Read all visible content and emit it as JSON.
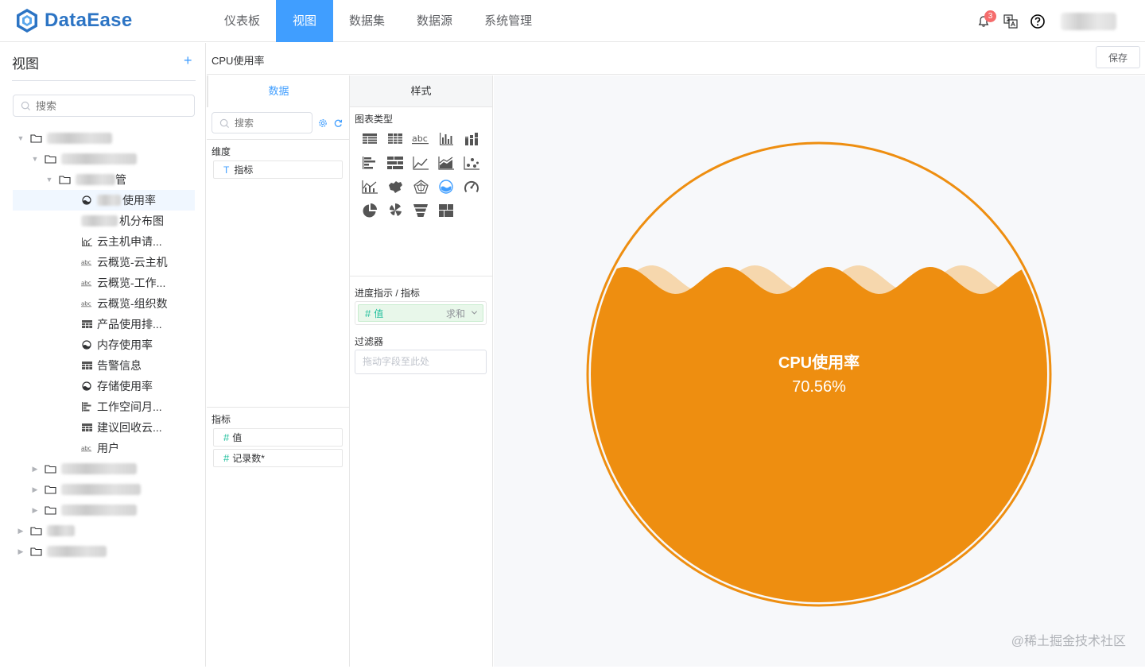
{
  "header": {
    "logo_text": "DataEase",
    "nav": [
      "仪表板",
      "视图",
      "数据集",
      "数据源",
      "系统管理"
    ],
    "active_nav": "视图",
    "notification_count": "3"
  },
  "sidebar": {
    "title": "视图",
    "add_symbol": "+",
    "search_placeholder": "搜索",
    "tree_partial": {
      "folder3_suffix": "管",
      "item1_suffix": "使用率",
      "item2_suffix": "机分布图"
    },
    "items": [
      {
        "label": "云主机申请...",
        "icon": "line-chart-icon"
      },
      {
        "label": "云概览-云主机",
        "icon": "text-abc-icon"
      },
      {
        "label": "云概览-工作...",
        "icon": "text-abc-icon"
      },
      {
        "label": "云概览-组织数",
        "icon": "text-abc-icon"
      },
      {
        "label": "产品使用排...",
        "icon": "table-icon"
      },
      {
        "label": "内存使用率",
        "icon": "liquid-icon"
      },
      {
        "label": "告警信息",
        "icon": "table-icon"
      },
      {
        "label": "存储使用率",
        "icon": "liquid-icon"
      },
      {
        "label": "工作空间月...",
        "icon": "bar-horizontal-icon"
      },
      {
        "label": "建议回收云...",
        "icon": "table-icon"
      },
      {
        "label": "用户",
        "icon": "text-abc-icon"
      }
    ]
  },
  "toolbar": {
    "view_name": "CPU使用率",
    "save_label": "保存"
  },
  "data_panel": {
    "tab_label": "数据",
    "search_placeholder": "搜索",
    "dimension_title": "维度",
    "dimensions": [
      {
        "type": "T",
        "name": "指标"
      }
    ],
    "quota_title": "指标",
    "quotas": [
      {
        "type": "#",
        "name": "值"
      },
      {
        "type": "#",
        "name": "记录数*"
      }
    ]
  },
  "style_panel": {
    "tab_label": "样式",
    "chart_type_title": "图表类型",
    "progress_title": "进度指示 / 指标",
    "progress_field": {
      "hash": "#",
      "name": "值",
      "agg": "求和"
    },
    "filter_title": "过滤器",
    "filter_placeholder": "拖动字段至此处"
  },
  "chart_data": {
    "type": "liquid",
    "title": "CPU使用率",
    "value": 0.7056,
    "value_text": "70.56%",
    "color": "#ee8e10"
  },
  "watermark": "@稀土掘金技术社区",
  "colors": {
    "primary": "#409eff",
    "liquid": "#ee8e10",
    "quota_green": "#1fbf9c"
  }
}
